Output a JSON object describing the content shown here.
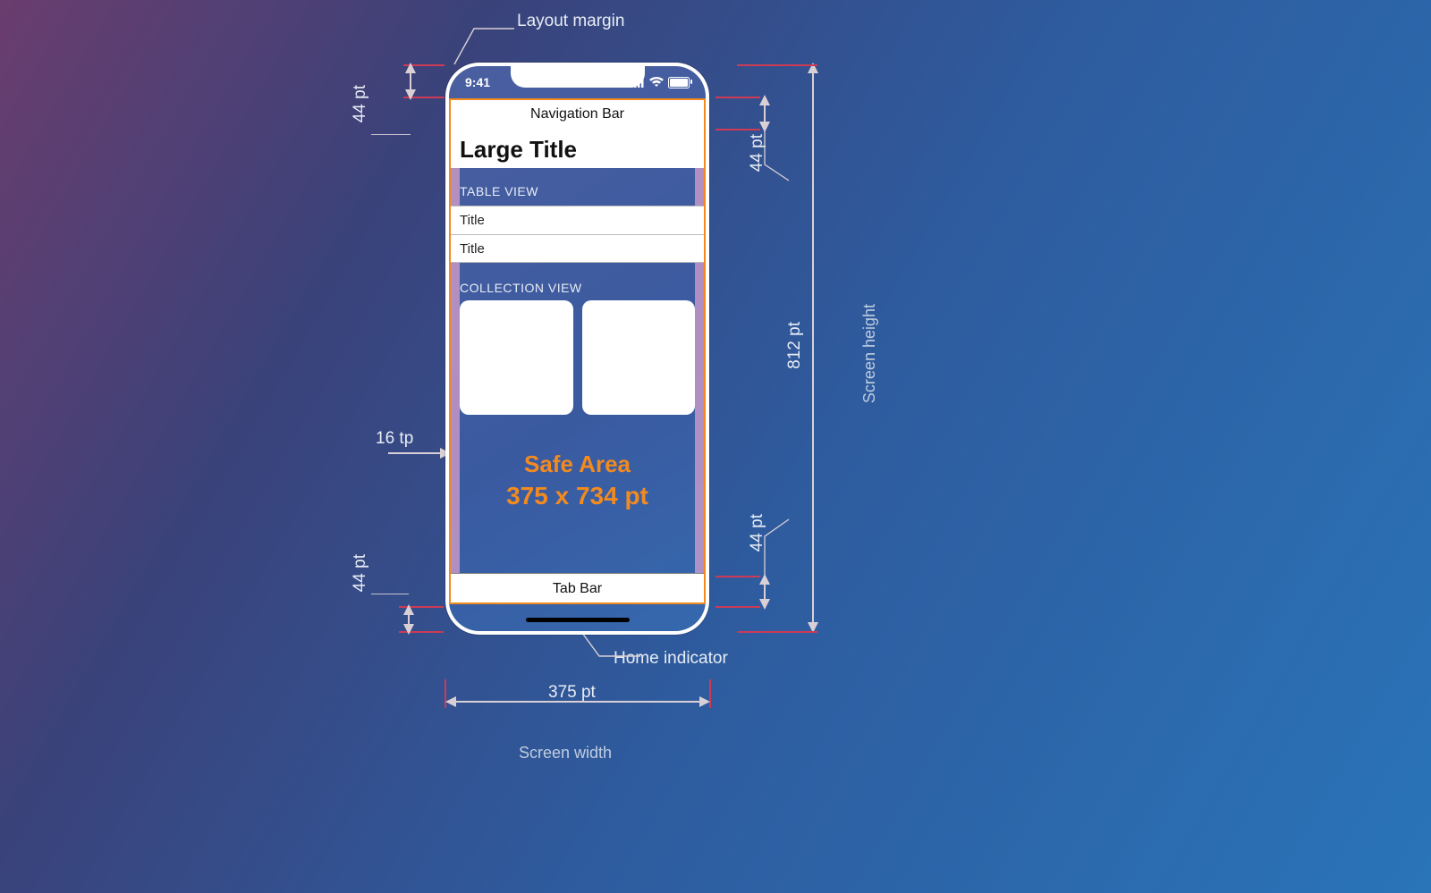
{
  "labels": {
    "layout_margin": "Layout margin",
    "home_indicator": "Home indicator",
    "screen_width": "Screen width",
    "screen_height": "Screen height"
  },
  "dims": {
    "status_bar": "44 pt",
    "nav_bar": "44 pt",
    "tab_bar": "44 pt",
    "home_indicator_hint": "44 pt",
    "layout_margin": "16 tp",
    "screen_width": "375 pt",
    "screen_height": "812 pt"
  },
  "phone": {
    "status_time": "9:41",
    "navigation_bar": "Navigation Bar",
    "large_title": "Large Title",
    "table_view_header": "TABLE VIEW",
    "table_rows": [
      "Title",
      "Title"
    ],
    "collection_view_header": "COLLECTION VIEW",
    "safe_area_line1": "Safe Area",
    "safe_area_line2": "375 x 734 pt",
    "tab_bar": "Tab Bar"
  },
  "chart_data": {
    "type": "diagram",
    "device": "iPhone X-class",
    "screen": {
      "width_pt": 375,
      "height_pt": 812
    },
    "safe_area": {
      "width_pt": 375,
      "height_pt": 734
    },
    "status_bar_height_pt": 44,
    "navigation_bar_height_pt": 44,
    "tab_bar_height_pt": 44,
    "home_indicator_region_height_pt": 44,
    "layout_margin_pt": 16,
    "components": [
      "Navigation Bar",
      "Large Title",
      "Table View",
      "Collection View",
      "Safe Area",
      "Tab Bar",
      "Home indicator"
    ]
  }
}
